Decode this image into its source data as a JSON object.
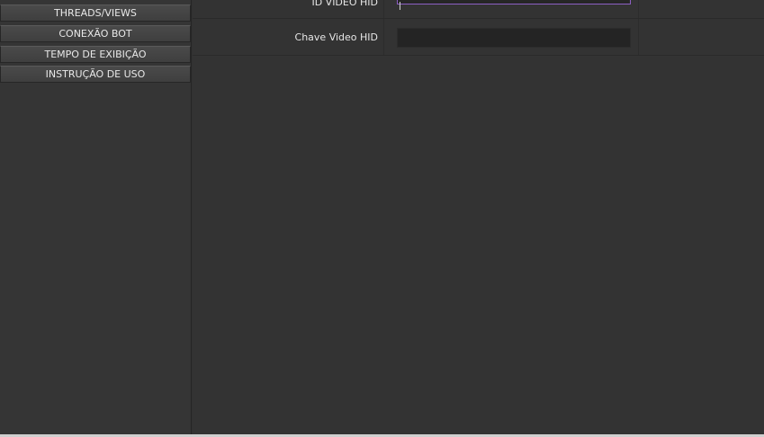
{
  "sidebar": {
    "items": [
      {
        "label": "THREADS/VIEWS"
      },
      {
        "label": "CONEXÃO BOT"
      },
      {
        "label": "TEMPO DE EXIBIÇÃO"
      },
      {
        "label": "INSTRUÇÃO DE USO"
      }
    ]
  },
  "form": {
    "row1": {
      "label": "ID VIDEO HID",
      "value": ""
    },
    "row2": {
      "label": "Chave Video HID",
      "value": ""
    }
  },
  "colors": {
    "background": "#323232",
    "sidebar_button": "#444444",
    "input_focus_border": "#8d5fc4",
    "input_background": "#262626"
  }
}
